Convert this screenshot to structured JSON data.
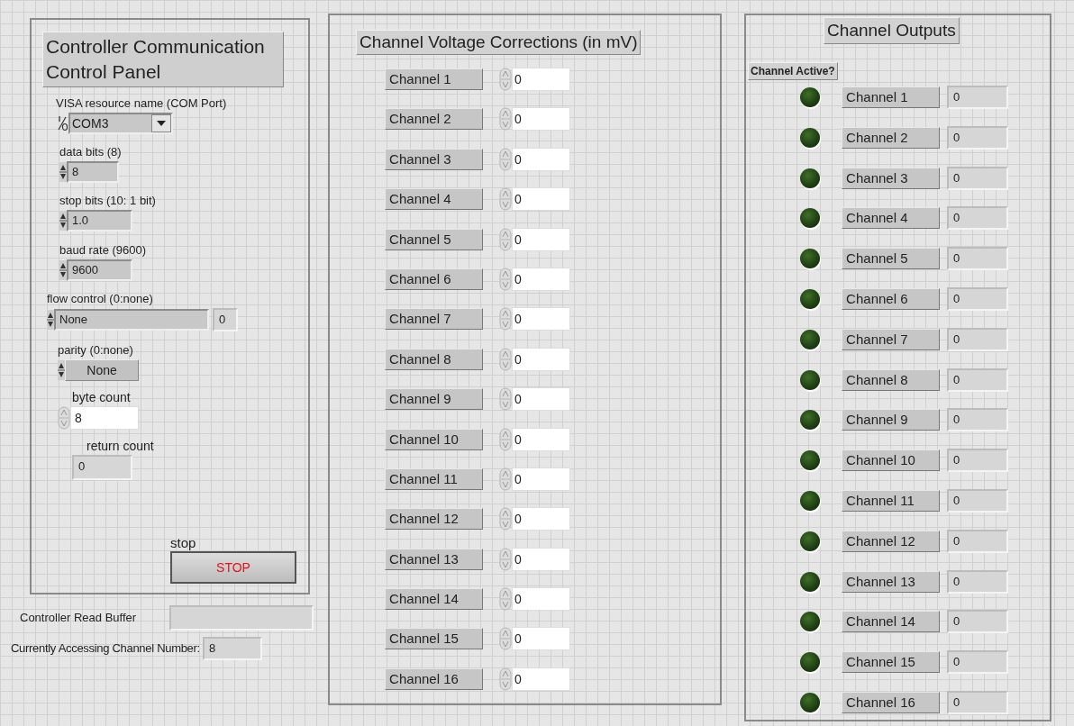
{
  "left_panel": {
    "title": "Controller Communication Control Panel",
    "controls": [
      {
        "kind": "combo",
        "label": "VISA resource name (COM Port)",
        "value": "COM3"
      },
      {
        "kind": "numeric",
        "label": "data bits (8)",
        "value": "8"
      },
      {
        "kind": "numeric",
        "label": "stop bits (10: 1 bit)",
        "value": "1.0"
      },
      {
        "kind": "numeric",
        "label": "baud rate (9600)",
        "value": "9600"
      },
      {
        "kind": "ring",
        "label": "flow control (0:none)",
        "value": "None",
        "index": "0"
      },
      {
        "kind": "ring",
        "label": "parity (0:none)",
        "value": "None"
      },
      {
        "kind": "spin",
        "label": "byte count",
        "value": "8"
      },
      {
        "kind": "indicator",
        "label": "return count",
        "value": "0"
      }
    ],
    "stop_button": {
      "label": "stop",
      "text": "STOP"
    }
  },
  "read_buffer": {
    "label": "Controller Read Buffer"
  },
  "channel_number": {
    "label": "Currently Accessing Channel Number:",
    "value": "8"
  },
  "corrections": {
    "title": "Channel Voltage Corrections (in mV)",
    "channels": [
      {
        "label": "Channel 1",
        "value": "0"
      },
      {
        "label": "Channel 2",
        "value": "0"
      },
      {
        "label": "Channel 3",
        "value": "0"
      },
      {
        "label": "Channel 4",
        "value": "0"
      },
      {
        "label": "Channel 5",
        "value": "0"
      },
      {
        "label": "Channel 6",
        "value": "0"
      },
      {
        "label": "Channel 7",
        "value": "0"
      },
      {
        "label": "Channel 8",
        "value": "0"
      },
      {
        "label": "Channel 9",
        "value": "0"
      },
      {
        "label": "Channel 10",
        "value": "0"
      },
      {
        "label": "Channel 11",
        "value": "0"
      },
      {
        "label": "Channel 12",
        "value": "0"
      },
      {
        "label": "Channel 13",
        "value": "0"
      },
      {
        "label": "Channel 14",
        "value": "0"
      },
      {
        "label": "Channel 15",
        "value": "0"
      },
      {
        "label": "Channel 16",
        "value": "0"
      }
    ]
  },
  "outputs": {
    "title": "Channel Outputs",
    "header": "Channel Active?",
    "channels": [
      {
        "on": false,
        "label": "Channel 1",
        "value": "0"
      },
      {
        "on": false,
        "label": "Channel 2",
        "value": "0"
      },
      {
        "on": false,
        "label": "Channel 3",
        "value": "0"
      },
      {
        "on": false,
        "label": "Channel 4",
        "value": "0"
      },
      {
        "on": false,
        "label": "Channel 5",
        "value": "0"
      },
      {
        "on": false,
        "label": "Channel 6",
        "value": "0"
      },
      {
        "on": false,
        "label": "Channel 7",
        "value": "0"
      },
      {
        "on": false,
        "label": "Channel 8",
        "value": "0"
      },
      {
        "on": false,
        "label": "Channel 9",
        "value": "0"
      },
      {
        "on": false,
        "label": "Channel 10",
        "value": "0"
      },
      {
        "on": false,
        "label": "Channel 11",
        "value": "0"
      },
      {
        "on": false,
        "label": "Channel 12",
        "value": "0"
      },
      {
        "on": false,
        "label": "Channel 13",
        "value": "0"
      },
      {
        "on": false,
        "label": "Channel 14",
        "value": "0"
      },
      {
        "on": false,
        "label": "Channel 15",
        "value": "0"
      },
      {
        "on": false,
        "label": "Channel 16",
        "value": "0"
      }
    ]
  }
}
